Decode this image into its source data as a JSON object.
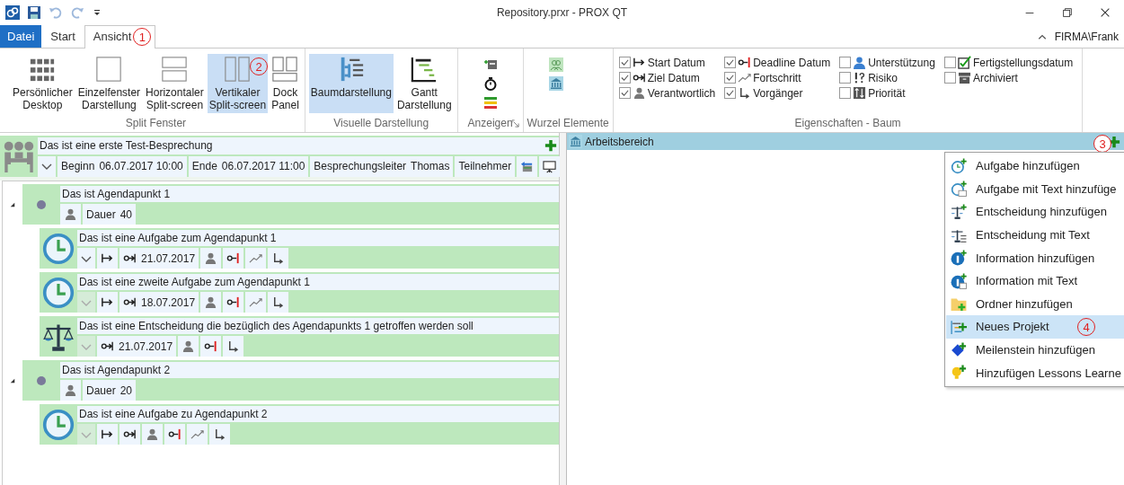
{
  "window": {
    "title": "Repository.prxr - PROX QT",
    "user": "FIRMA\\Frank"
  },
  "tabs": [
    {
      "label": "Datei",
      "kind": "file",
      "selected": false
    },
    {
      "label": "Start",
      "kind": "tab",
      "selected": false
    },
    {
      "label": "Ansicht",
      "kind": "tab",
      "selected": true,
      "callout": "1"
    }
  ],
  "ribbon": [
    {
      "label": "Split Fenster",
      "kind": "large",
      "buttons": [
        {
          "label": "Persönlicher\nDesktop",
          "kind": "grid",
          "selected": false
        },
        {
          "label": "Einzelfenster\nDarstellung",
          "kind": "single",
          "selected": false
        },
        {
          "label": "Horizontaler\nSplit-screen",
          "kind": "hsplit",
          "selected": false
        },
        {
          "label": "Vertikaler\nSplit-screen",
          "kind": "vsplit",
          "selected": true,
          "callout": "2"
        },
        {
          "label": "Dock\nPanel",
          "kind": "dock",
          "selected": false
        }
      ]
    },
    {
      "label": "Visuelle Darstellung",
      "kind": "large",
      "buttons": [
        {
          "label": "Baumdarstellung",
          "kind": "tree",
          "selected": true
        },
        {
          "label": "Gantt\nDarstellung",
          "kind": "gantt",
          "selected": false
        }
      ]
    },
    {
      "label": "Anzeigen",
      "kind": "small",
      "launcher": true,
      "buttons": [
        {
          "kind": "additem"
        },
        {
          "kind": "stopwatch"
        },
        {
          "kind": "traffic"
        }
      ]
    },
    {
      "label": "Wurzel Elemente",
      "kind": "small",
      "buttons": [
        {
          "kind": "people"
        },
        {
          "kind": "bank"
        }
      ]
    },
    {
      "label": "Eigenschaften - Baum",
      "kind": "checks",
      "columns": [
        [
          {
            "label": "Start Datum",
            "kind": "start",
            "checked": true
          },
          {
            "label": "Ziel Datum",
            "kind": "target",
            "checked": true
          },
          {
            "label": "Verantwortlich",
            "kind": "person",
            "checked": true
          }
        ],
        [
          {
            "label": "Deadline Datum",
            "kind": "deadline",
            "checked": true
          },
          {
            "label": "Fortschritt",
            "kind": "progress",
            "checked": true
          },
          {
            "label": "Vorgänger",
            "kind": "predecessor",
            "checked": true
          }
        ],
        [
          {
            "label": "Unterstützung",
            "kind": "support",
            "checked": false
          },
          {
            "label": "Risiko",
            "kind": "risk",
            "checked": false
          },
          {
            "label": "Priorität",
            "kind": "priority",
            "checked": false
          }
        ],
        [
          {
            "label": "Fertigstellungsdatum",
            "kind": "completion",
            "checked": false
          },
          {
            "label": "Archiviert",
            "kind": "archive",
            "checked": false
          }
        ]
      ]
    }
  ],
  "meeting": {
    "title": "Das ist eine erste Test-Besprechung",
    "fields": [
      {
        "kind": "chevron",
        "enabled": true
      },
      {
        "kind": "field",
        "label": "Beginn",
        "value": "06.07.2017 10:00"
      },
      {
        "kind": "field",
        "label": "Ende",
        "value": "06.07.2017 11:00"
      },
      {
        "kind": "field",
        "label": "Besprechungsleiter",
        "value": "Thomas"
      },
      {
        "kind": "field",
        "label": "Teilnehmer"
      },
      {
        "kind": "transfer"
      },
      {
        "kind": "presentation"
      }
    ]
  },
  "tree": [
    {
      "kind": "agenda",
      "title": "Das ist Agendapunkt 1",
      "expanded": true,
      "fields": [
        {
          "kind": "person"
        },
        {
          "kind": "field",
          "label": "Dauer",
          "value": "40"
        }
      ],
      "children": [
        {
          "kind": "task",
          "title": "Das ist eine Aufgabe zum Agendapunkt 1",
          "fields": [
            {
              "kind": "chevron",
              "enabled": true
            },
            {
              "kind": "start"
            },
            {
              "kind": "target",
              "value": "21.07.2017"
            },
            {
              "kind": "person"
            },
            {
              "kind": "deadline"
            },
            {
              "kind": "progress"
            },
            {
              "kind": "predecessor"
            }
          ]
        },
        {
          "kind": "task",
          "title": "Das ist eine zweite Aufgabe zum Agendapunkt 1",
          "fields": [
            {
              "kind": "chevron",
              "enabled": false
            },
            {
              "kind": "start"
            },
            {
              "kind": "target",
              "value": "18.07.2017"
            },
            {
              "kind": "person"
            },
            {
              "kind": "deadline"
            },
            {
              "kind": "progress"
            },
            {
              "kind": "predecessor"
            }
          ]
        },
        {
          "kind": "decision",
          "title": "Das ist eine Entscheidung die bezüglich des Agendapunkts 1 getroffen werden soll",
          "fields": [
            {
              "kind": "chevron",
              "enabled": false
            },
            {
              "kind": "target",
              "value": "21.07.2017"
            },
            {
              "kind": "person"
            },
            {
              "kind": "deadline"
            },
            {
              "kind": "predecessor"
            }
          ]
        }
      ]
    },
    {
      "kind": "agenda",
      "title": "Das ist Agendapunkt 2",
      "expanded": true,
      "fields": [
        {
          "kind": "person"
        },
        {
          "kind": "field",
          "label": "Dauer",
          "value": "20"
        }
      ],
      "children": [
        {
          "kind": "task",
          "title": "Das ist eine Aufgabe zu Agendapunkt 2",
          "fields": [
            {
              "kind": "chevron",
              "enabled": false
            },
            {
              "kind": "start"
            },
            {
              "kind": "target"
            },
            {
              "kind": "person"
            },
            {
              "kind": "deadline"
            },
            {
              "kind": "progress"
            },
            {
              "kind": "predecessor"
            }
          ]
        }
      ]
    }
  ],
  "workspace": {
    "title": "Arbeitsbereich",
    "callout": "3",
    "menu": [
      {
        "label": "Aufgabe hinzufügen",
        "kind": "clockplus",
        "selected": false
      },
      {
        "label": "Aufgabe mit Text hinzufüge",
        "kind": "clocktext",
        "selected": false
      },
      {
        "label": "Entscheidung hinzufügen",
        "kind": "scalesplus",
        "selected": false
      },
      {
        "label": "Entscheidung mit Text",
        "kind": "scalestext",
        "selected": false
      },
      {
        "label": "Information hinzufügen",
        "kind": "infoplus",
        "selected": false
      },
      {
        "label": "Information mit Text",
        "kind": "infotext",
        "selected": false
      },
      {
        "label": "Ordner hinzufügen",
        "kind": "folderplus",
        "selected": false
      },
      {
        "label": "Neues Projekt",
        "kind": "projectplus",
        "selected": true,
        "callout": "4"
      },
      {
        "label": "Meilenstein hinzufügen",
        "kind": "diamondplus",
        "selected": false
      },
      {
        "label": "Hinzufügen Lessons Learne",
        "kind": "bulbplus",
        "selected": false
      }
    ]
  }
}
